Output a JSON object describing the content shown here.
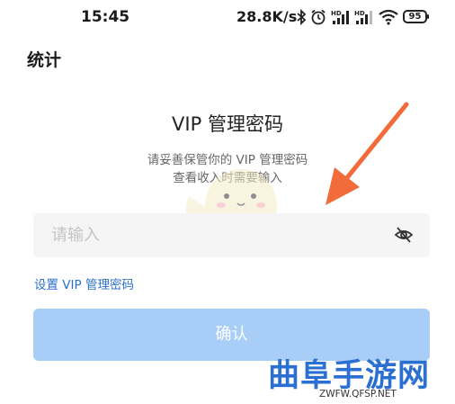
{
  "status_bar": {
    "time": "15:45",
    "net_speed": "28.8K/s",
    "battery": "95"
  },
  "page": {
    "title": "统计"
  },
  "dialog": {
    "heading": "VIP 管理密码",
    "desc_line1": "请妥善保管你的 VIP 管理密码",
    "desc_line2": "查看收入时需要输入"
  },
  "password_input": {
    "placeholder": "请输入",
    "value": ""
  },
  "set_password_link": "设置 VIP 管理密码",
  "confirm_button": "确认",
  "watermark": {
    "logo": "曲阜手游网",
    "url": "ZWFW.QFSP.NET"
  },
  "colors": {
    "link": "#2a6fc9",
    "button_disabled": "#a8cdf6",
    "arrow": "#f26b3a",
    "watermark": "#2a6fd1"
  }
}
